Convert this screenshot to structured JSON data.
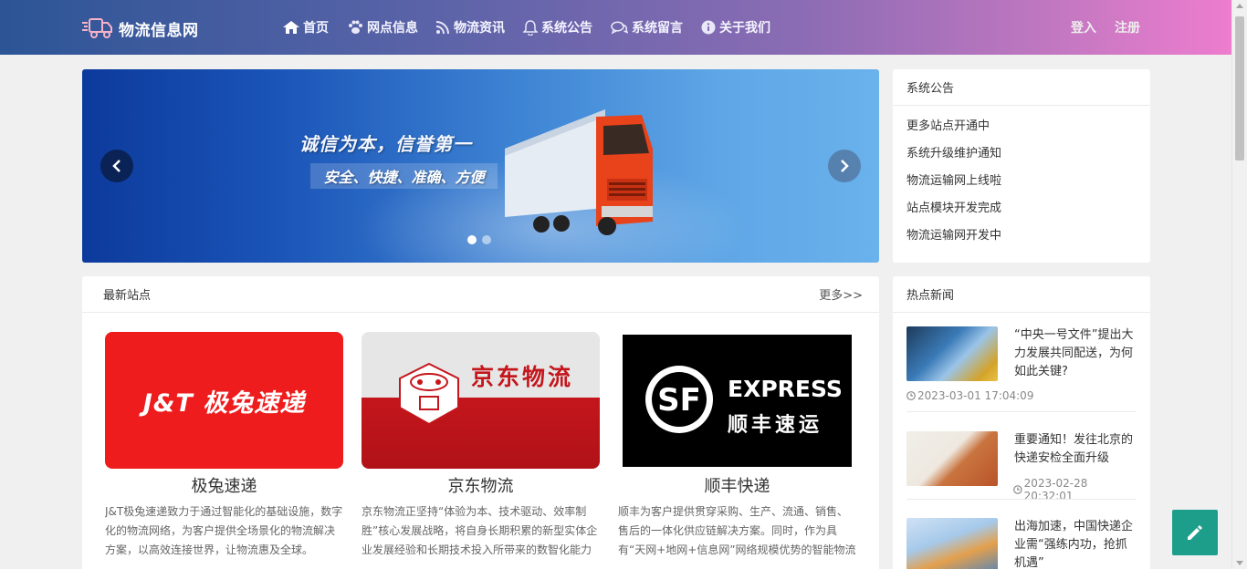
{
  "nav": {
    "logo_text": "物流信息网",
    "items": [
      {
        "label": "首页",
        "icon": "home-icon"
      },
      {
        "label": "网点信息",
        "icon": "paw-icon"
      },
      {
        "label": "物流资讯",
        "icon": "rss-icon"
      },
      {
        "label": "系统公告",
        "icon": "bell-icon"
      },
      {
        "label": "系统留言",
        "icon": "comments-icon"
      },
      {
        "label": "关于我们",
        "icon": "info-icon"
      }
    ],
    "login": "登入",
    "register": "注册"
  },
  "banner": {
    "line1": "诚信为本，信誉第一",
    "line2": "安全、快捷、准确、方便",
    "active_slide": 1,
    "slide_count": 2
  },
  "notice": {
    "title": "系统公告",
    "items": [
      "更多站点开通中",
      "系统升级维护通知",
      "物流运输网上线啦",
      "站点模块开发完成",
      "物流运输网开发中"
    ]
  },
  "sites": {
    "title": "最新站点",
    "more": "更多>>",
    "items": [
      {
        "name": "极兔速递",
        "logo_text": "J&T 极兔速递",
        "brand_color": "#ee1c1c",
        "desc": "J&T极兔速递致力于通过智能化的基础设施，数字化的物流网络，为客户提供全场景化的物流解决方案，以高效连接世界，让物流惠及全球。"
      },
      {
        "name": "京东物流",
        "logo_text": "京东物流",
        "brand_color": "#c4161c",
        "desc": "京东物流正坚持“体验为本、技术驱动、效率制胜”核心发展战略，将自身长期积累的新型实体企业发展经验和长期技术投入所带来的数智化能力持"
      },
      {
        "name": "顺丰快递",
        "logo_text_en": "EXPRESS",
        "logo_text_cn": "顺丰速运",
        "brand_color": "#000000",
        "desc": "顺丰为客户提供贯穿采购、生产、流通、销售、售后的一体化供应链解决方案。同时，作为具有“天网+地网+信息网”网络规模优势的智能物流运"
      }
    ]
  },
  "news": {
    "title": "热点新闻",
    "items": [
      {
        "title": "“中央一号文件”提出大力发展共同配送，为何如此关键?",
        "time": "2023-03-01 17:04:09"
      },
      {
        "title": "重要通知！发往北京的快递安检全面升级",
        "time": "2023-02-28 20:32:01"
      },
      {
        "title": "出海加速，中国快递企业需“强练内功，抢抓机遇”",
        "time": ""
      }
    ]
  },
  "colors": {
    "nav_gradient_start": "#2c5596",
    "nav_gradient_end": "#ee7dce",
    "fab": "#1d9e8a"
  }
}
